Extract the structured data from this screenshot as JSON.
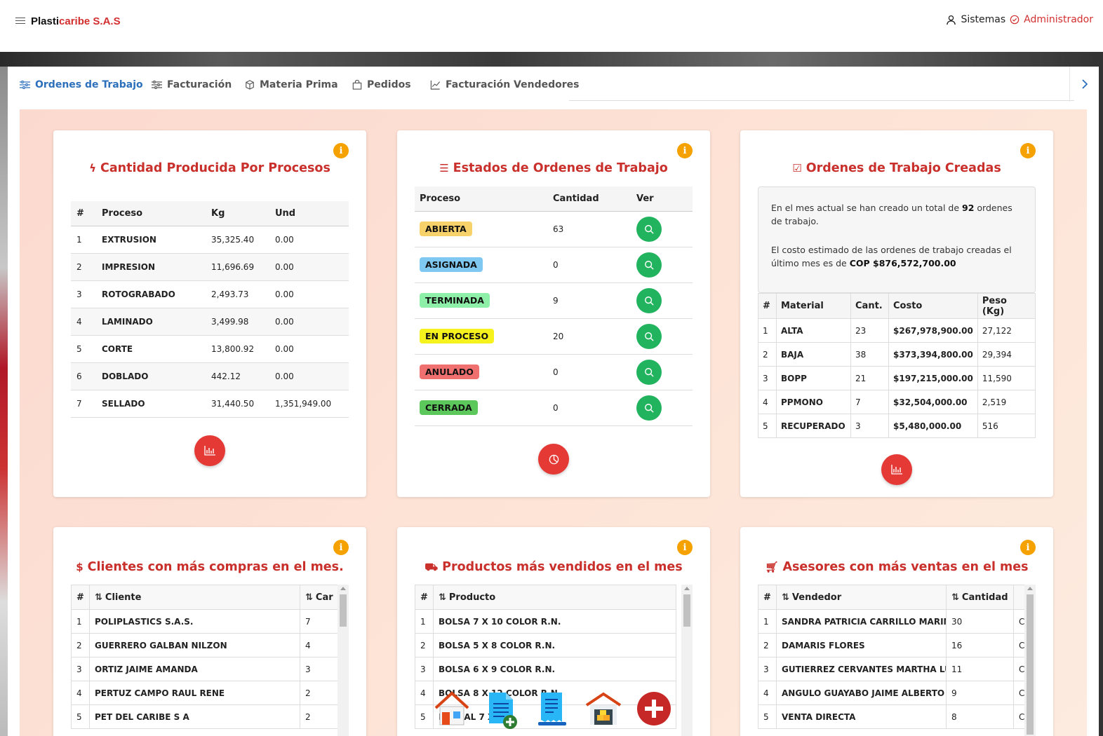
{
  "header": {
    "brand_prefix": "Plasti",
    "brand_accent": "caribe S.A.S",
    "user_name": "Sistemas",
    "user_role": "Administrador"
  },
  "tabs": [
    {
      "label": "Ordenes de Trabajo",
      "icon": "sliders-icon",
      "active": true
    },
    {
      "label": "Facturación",
      "icon": "sliders-icon",
      "active": false
    },
    {
      "label": "Materia Prima",
      "icon": "box-icon",
      "active": false
    },
    {
      "label": "Pedidos",
      "icon": "bag-icon",
      "active": false
    },
    {
      "label": "Facturación Vendedores",
      "icon": "chart-line-icon",
      "active": false
    }
  ],
  "card_procesos": {
    "title": "Cantidad Producida Por Procesos",
    "headers": [
      "#",
      "Proceso",
      "Kg",
      "Und"
    ],
    "rows": [
      [
        "1",
        "EXTRUSION",
        "35,325.40",
        "0.00"
      ],
      [
        "2",
        "IMPRESION",
        "11,696.69",
        "0.00"
      ],
      [
        "3",
        "ROTOGRABADO",
        "2,493.73",
        "0.00"
      ],
      [
        "4",
        "LAMINADO",
        "3,499.98",
        "0.00"
      ],
      [
        "5",
        "CORTE",
        "13,800.92",
        "0.00"
      ],
      [
        "6",
        "DOBLADO",
        "442.12",
        "0.00"
      ],
      [
        "7",
        "SELLADO",
        "31,440.50",
        "1,351,949.00"
      ]
    ]
  },
  "card_estados": {
    "title": "Estados de Ordenes de Trabajo",
    "headers": [
      "Proceso",
      "Cantidad",
      "Ver"
    ],
    "rows": [
      {
        "estado": "ABIERTA",
        "cantidad": "63",
        "color": "#f7d26a"
      },
      {
        "estado": "ASIGNADA",
        "cantidad": "0",
        "color": "#7ec8f2"
      },
      {
        "estado": "TERMINADA",
        "cantidad": "9",
        "color": "#8ef0a8"
      },
      {
        "estado": "EN PROCESO",
        "cantidad": "20",
        "color": "#f5f21e"
      },
      {
        "estado": "ANULADO",
        "cantidad": "0",
        "color": "#f07070"
      },
      {
        "estado": "CERRADA",
        "cantidad": "0",
        "color": "#5cc85c"
      }
    ]
  },
  "card_creadas": {
    "title": "Ordenes de Trabajo Creadas",
    "text1_a": "En el mes actual se han creado un total de ",
    "text1_num": "92",
    "text1_b": " ordenes de trabajo.",
    "text2_a": "El costo estimado de las ordenes de trabajo creadas el último mes es de ",
    "text2_amount": "COP $876,572,700.00",
    "headers": [
      "#",
      "Material",
      "Cant.",
      "Costo",
      "Peso (Kg)"
    ],
    "rows": [
      [
        "1",
        "ALTA",
        "23",
        "$267,978,900.00",
        "27,122"
      ],
      [
        "2",
        "BAJA",
        "38",
        "$373,394,800.00",
        "29,394"
      ],
      [
        "3",
        "BOPP",
        "21",
        "$197,215,000.00",
        "11,590"
      ],
      [
        "4",
        "PPMONO",
        "7",
        "$32,504,000.00",
        "2,519"
      ],
      [
        "5",
        "RECUPERADO",
        "3",
        "$5,480,000.00",
        "516"
      ]
    ]
  },
  "card_clientes": {
    "title": "Clientes con más compras en el mes.",
    "headers": [
      "#",
      "Cliente",
      "Car"
    ],
    "rows": [
      [
        "1",
        "POLIPLASTICS S.A.S.",
        "7"
      ],
      [
        "2",
        "GUERRERO GALBAN NILZON",
        "4"
      ],
      [
        "3",
        "ORTIZ JAIME AMANDA",
        "3"
      ],
      [
        "4",
        "PERTUZ CAMPO RAUL RENE",
        "2"
      ],
      [
        "5",
        "PET DEL CARIBE S A",
        "2"
      ]
    ]
  },
  "card_productos": {
    "title": "Productos más vendidos en el mes",
    "headers": [
      "#",
      "Producto"
    ],
    "rows": [
      [
        "1",
        "BOLSA 7 X 10 COLOR R.N."
      ],
      [
        "2",
        "BOLSA 5 X 8 COLOR R.N."
      ],
      [
        "3",
        "BOLSA 6 X 9 COLOR R.N."
      ],
      [
        "4",
        "BOLSA 8 X 12 COLOR R.N."
      ],
      [
        "5",
        "BAJA            AL 7 X"
      ]
    ]
  },
  "card_asesores": {
    "title": "Asesores con más ventas en el mes",
    "headers": [
      "#",
      "Vendedor",
      "Cantidad",
      ""
    ],
    "rows": [
      [
        "1",
        "SANDRA PATRICIA CARRILLO MARIMÓN",
        "30",
        "C("
      ],
      [
        "2",
        "DAMARIS FLORES",
        "16",
        "C("
      ],
      [
        "3",
        "GUTIERREZ CERVANTES MARTHA LUCIA",
        "11",
        "C("
      ],
      [
        "4",
        "ANGULO GUAYABO JAIME ALBERTO",
        "9",
        "C("
      ],
      [
        "5",
        "VENTA DIRECTA",
        "8",
        "C("
      ]
    ]
  },
  "dock": [
    "home-icon",
    "new-document-icon",
    "receipt-icon",
    "warehouse-icon",
    "add-circle-icon"
  ],
  "colors": {
    "accent": "#c9302c",
    "tab_active": "#2c6fbb",
    "info": "#f5a100",
    "view": "#22b35f",
    "chart_btn": "#e53935"
  }
}
